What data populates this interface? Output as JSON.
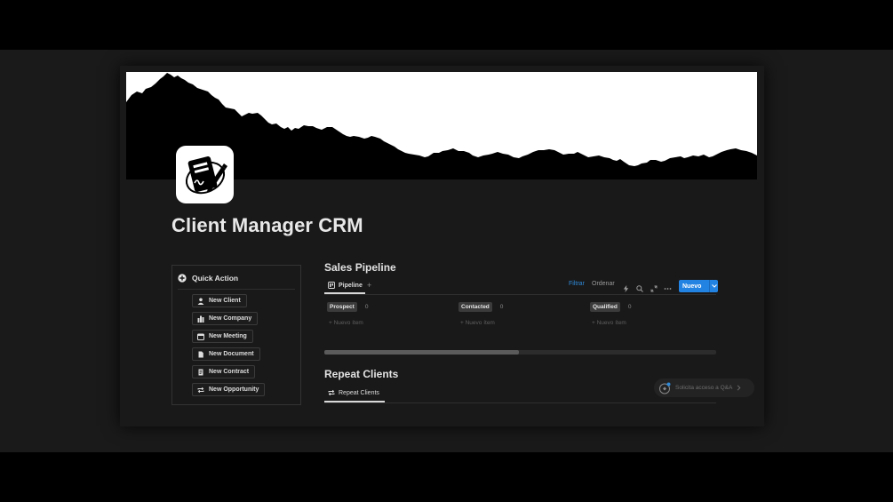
{
  "page": {
    "title": "Client Manager CRM"
  },
  "quick_action": {
    "header": "Quick Action",
    "buttons": [
      {
        "label": "New Client",
        "icon": "person-icon"
      },
      {
        "label": "New Company",
        "icon": "building-icon"
      },
      {
        "label": "New Meeting",
        "icon": "calendar-icon"
      },
      {
        "label": "New Document",
        "icon": "document-icon"
      },
      {
        "label": "New Contract",
        "icon": "contract-icon"
      },
      {
        "label": "New Opportunity",
        "icon": "repeat-icon"
      }
    ]
  },
  "sales_pipeline": {
    "heading": "Sales Pipeline",
    "tab_label": "Pipeline",
    "toolbar": {
      "filter": "Filtrar",
      "sort": "Ordenar",
      "new_button": "Nuevo"
    },
    "columns": [
      {
        "name": "Prospect",
        "count": "0",
        "new_item": "Nuevo ítem"
      },
      {
        "name": "Contacted",
        "count": "0",
        "new_item": "Nuevo ítem"
      },
      {
        "name": "Qualified",
        "count": "0",
        "new_item": "Nuevo ítem"
      }
    ]
  },
  "repeat_clients": {
    "heading": "Repeat Clients",
    "tab_label": "Repeat Clients"
  },
  "access_prompt": {
    "label": "Solicita acceso a Q&A"
  },
  "colors": {
    "accent": "#2383e2",
    "filter_link": "#2e89d8",
    "background": "#191919"
  }
}
